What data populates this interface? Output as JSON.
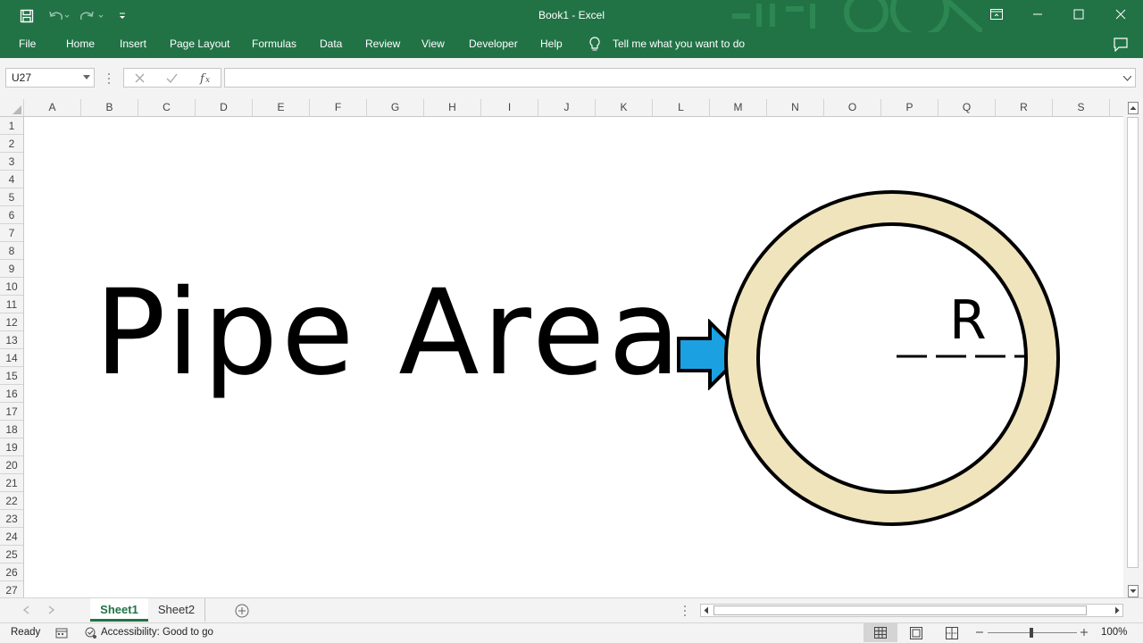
{
  "window": {
    "title": "Book1  -  Excel",
    "accent": "#217346"
  },
  "menu": {
    "items": [
      "File",
      "Home",
      "Insert",
      "Page Layout",
      "Formulas",
      "Data",
      "Review",
      "View",
      "Developer",
      "Help"
    ],
    "tell_me": "Tell me what you want to do"
  },
  "formula_bar": {
    "name_box": "U27",
    "formula": ""
  },
  "columns": [
    "A",
    "B",
    "C",
    "D",
    "E",
    "F",
    "G",
    "H",
    "I",
    "J",
    "K",
    "L",
    "M",
    "N",
    "O",
    "P",
    "Q",
    "R",
    "S"
  ],
  "rows": [
    "1",
    "2",
    "3",
    "4",
    "5",
    "6",
    "7",
    "8",
    "9",
    "10",
    "11",
    "12",
    "13",
    "14",
    "15",
    "16",
    "17",
    "18",
    "19",
    "20",
    "21",
    "22",
    "23",
    "24",
    "25",
    "26",
    "27"
  ],
  "sheet_content": {
    "title_text": "Pipe Area",
    "radius_label": "R",
    "arrow_color": "#1ba1e2",
    "pipe_wall_color": "#f0e4bd"
  },
  "tabs": {
    "sheets": [
      "Sheet1",
      "Sheet2"
    ],
    "active": "Sheet1"
  },
  "status": {
    "mode": "Ready",
    "accessibility": "Accessibility: Good to go",
    "zoom": "100%"
  }
}
